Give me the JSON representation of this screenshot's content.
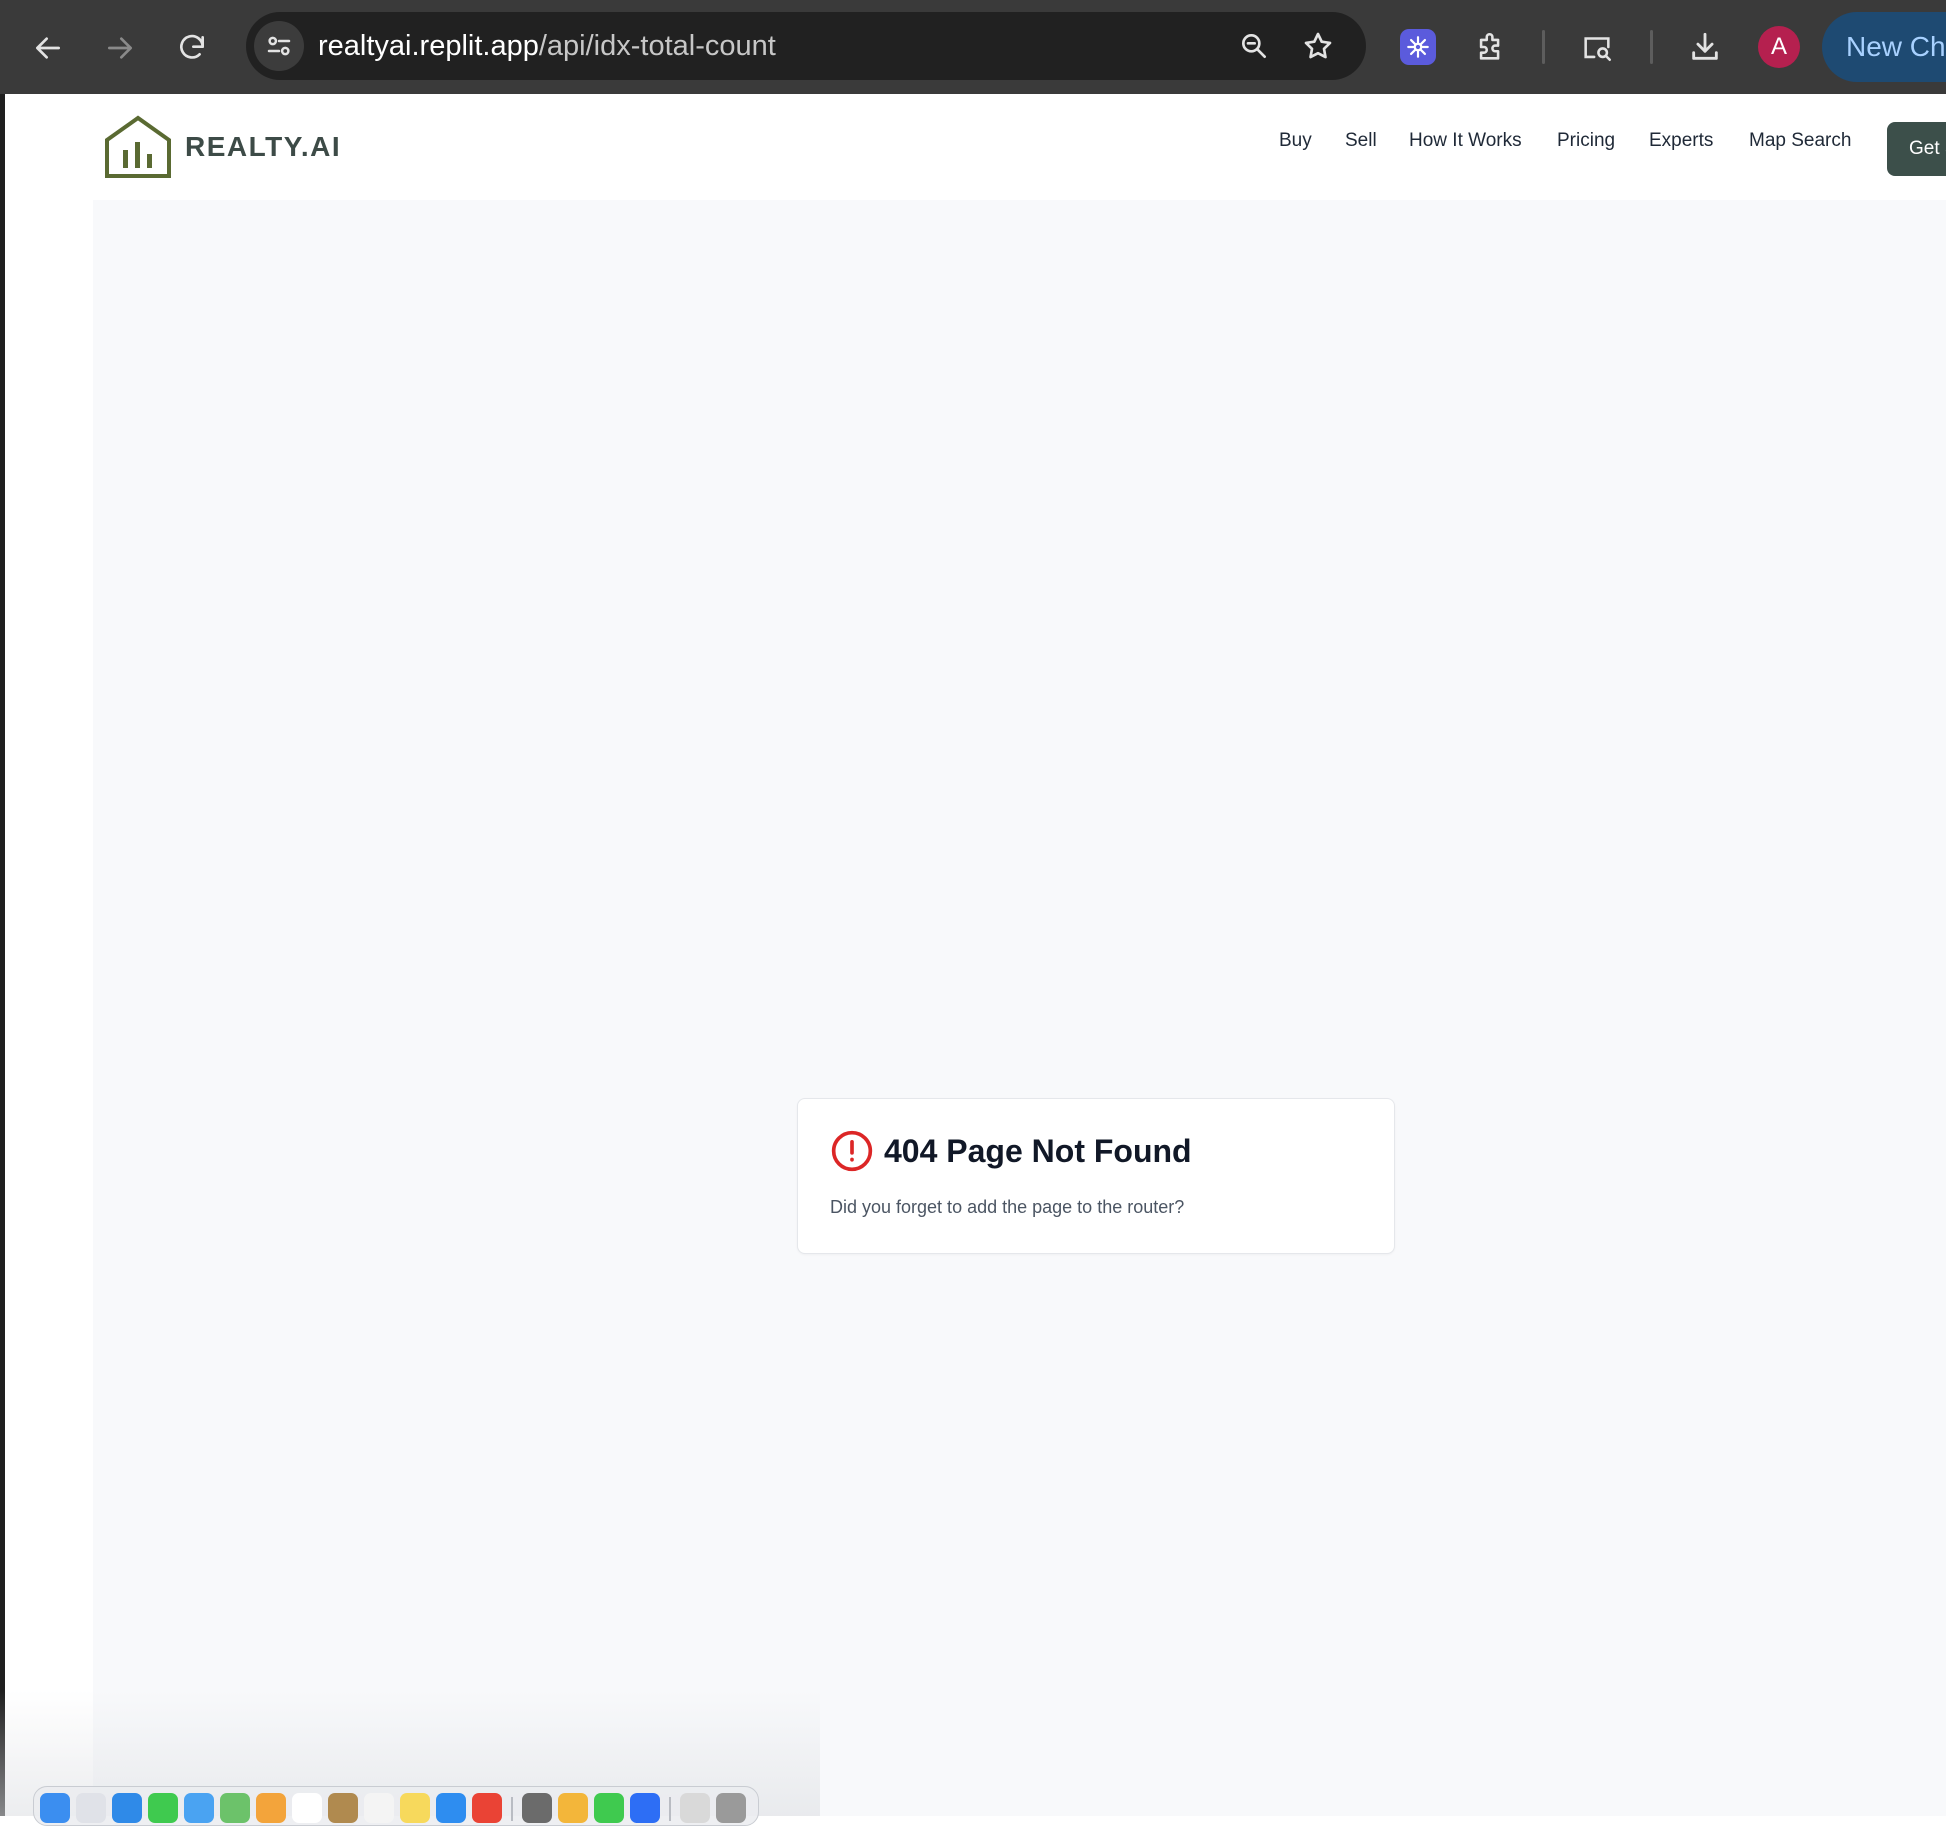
{
  "browser": {
    "url_host": "realtyai.replit.app",
    "url_path": "/api/idx-total-count",
    "profile_initial": "A",
    "promo_button_label": "New Chr",
    "icons": {
      "back": "arrow-left-icon",
      "forward": "arrow-right-icon",
      "reload": "reload-icon",
      "site_info": "tune-icon",
      "zoom": "zoom-icon",
      "bookmark": "star-icon",
      "extension_ai": "sparkle-icon",
      "extensions": "puzzle-icon",
      "tab_search": "tab-search-icon",
      "downloads": "download-icon"
    },
    "colors": {
      "toolbar": "#3a3a3a",
      "omnibox": "#212121",
      "avatar": "#b5204f",
      "promo": "#1e4a72"
    }
  },
  "site": {
    "brand": "REALTY.AI",
    "nav": [
      {
        "label": "Buy"
      },
      {
        "label": "Sell"
      },
      {
        "label": "How It Works"
      },
      {
        "label": "Pricing"
      },
      {
        "label": "Experts"
      },
      {
        "label": "Map Search"
      }
    ],
    "cta_label": "Get S",
    "colors": {
      "brand_olive": "#5a6a32",
      "brand_text": "#3d4b47",
      "cta": "#3c4f4a"
    }
  },
  "error_card": {
    "title": "404 Page Not Found",
    "description": "Did you forget to add the page to the router?",
    "icon": "alert-circle-icon",
    "icon_color": "#dc2626"
  },
  "dock": {
    "apps": [
      {
        "name": "finder-icon",
        "color": "#3b8ef0"
      },
      {
        "name": "launchpad-icon",
        "color": "#e0e2e8"
      },
      {
        "name": "safari-icon",
        "color": "#2f8ae8"
      },
      {
        "name": "messages-icon",
        "color": "#3fca4f"
      },
      {
        "name": "mail-icon",
        "color": "#4aa3f2"
      },
      {
        "name": "maps-icon",
        "color": "#6cc26a"
      },
      {
        "name": "photos-icon",
        "color": "#f3a43b"
      },
      {
        "name": "calendar-icon",
        "color": "#ffffff"
      },
      {
        "name": "notes-brown-icon",
        "color": "#b08a4f"
      },
      {
        "name": "reminders-icon",
        "color": "#f4f4f4"
      },
      {
        "name": "notes-icon",
        "color": "#f7d95c"
      },
      {
        "name": "app-store-icon",
        "color": "#2e8df0"
      },
      {
        "name": "chrome-icon",
        "color": "#ea4335"
      },
      {
        "name": "system-settings-icon",
        "color": "#6b6b6b"
      },
      {
        "name": "chrome-canary-icon",
        "color": "#f3b63a"
      },
      {
        "name": "facetime-icon",
        "color": "#3fca4f"
      },
      {
        "name": "zoom-app-icon",
        "color": "#2d6ef5"
      },
      {
        "name": "preview-icon",
        "color": "#d9d9d9"
      },
      {
        "name": "trash-icon",
        "color": "#9a9a9a"
      }
    ]
  }
}
